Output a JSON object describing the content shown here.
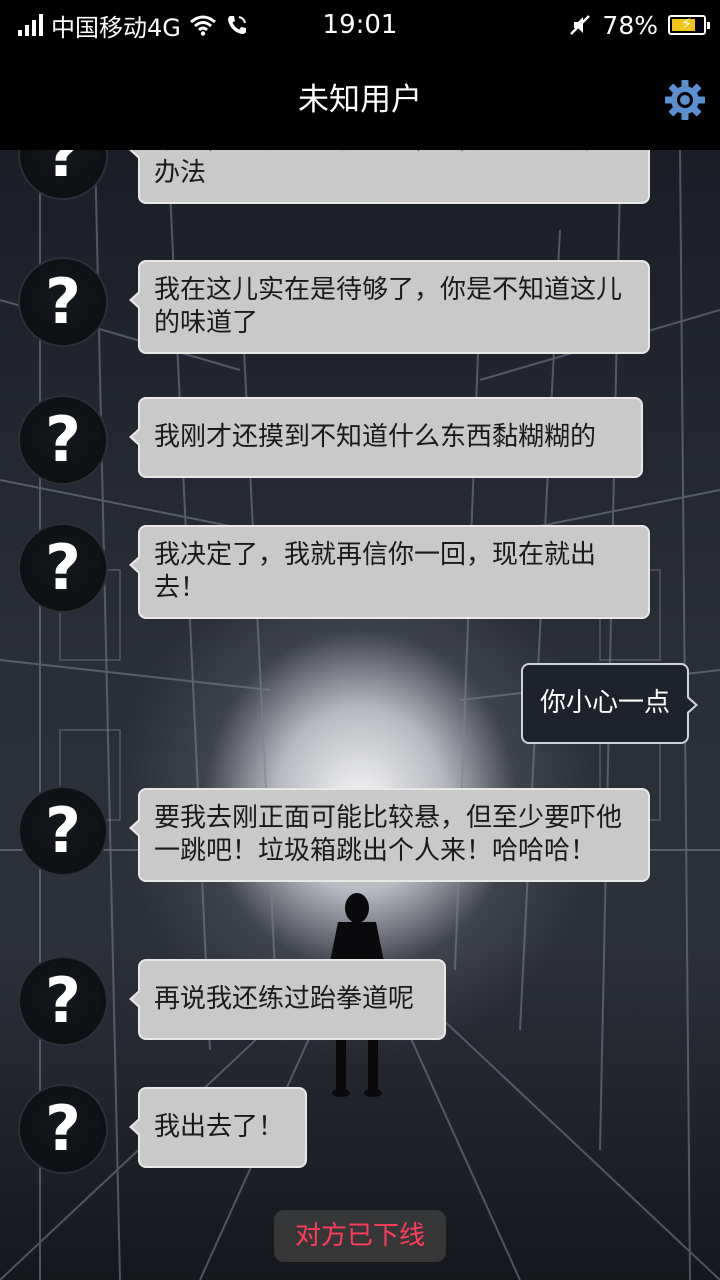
{
  "status_bar": {
    "carrier": "中国移动4G",
    "time": "19:01",
    "battery": "78%",
    "battery_level": 0.78,
    "icons": [
      "signal-icon",
      "wifi-icon",
      "call-icon",
      "mute-icon",
      "battery-charging-icon"
    ]
  },
  "header": {
    "title": "未知用户",
    "settings_icon": "gear-icon",
    "accent_color": "#5a8fd0"
  },
  "avatar_glyph": "?",
  "messages": [
    {
      "from": "other",
      "text": "不过，你说的也有道理，我现在也没什么办法"
    },
    {
      "from": "other",
      "text": "我在这儿实在是待够了，你是不知道这儿的味道了"
    },
    {
      "from": "other",
      "text": "我刚才还摸到不知道什么东西黏糊糊的"
    },
    {
      "from": "other",
      "text": "我决定了，我就再信你一回，现在就出去！"
    },
    {
      "from": "me",
      "text": "你小心一点"
    },
    {
      "from": "other",
      "text": "要我去刚正面可能比较悬，但至少要吓他一跳吧！垃圾箱跳出个人来！哈哈哈！"
    },
    {
      "from": "other",
      "text": "再说我还练过跆拳道呢"
    },
    {
      "from": "other",
      "text": "我出去了！"
    }
  ],
  "system_notice": "对方已下线",
  "notice_color": "#ff3d5a"
}
